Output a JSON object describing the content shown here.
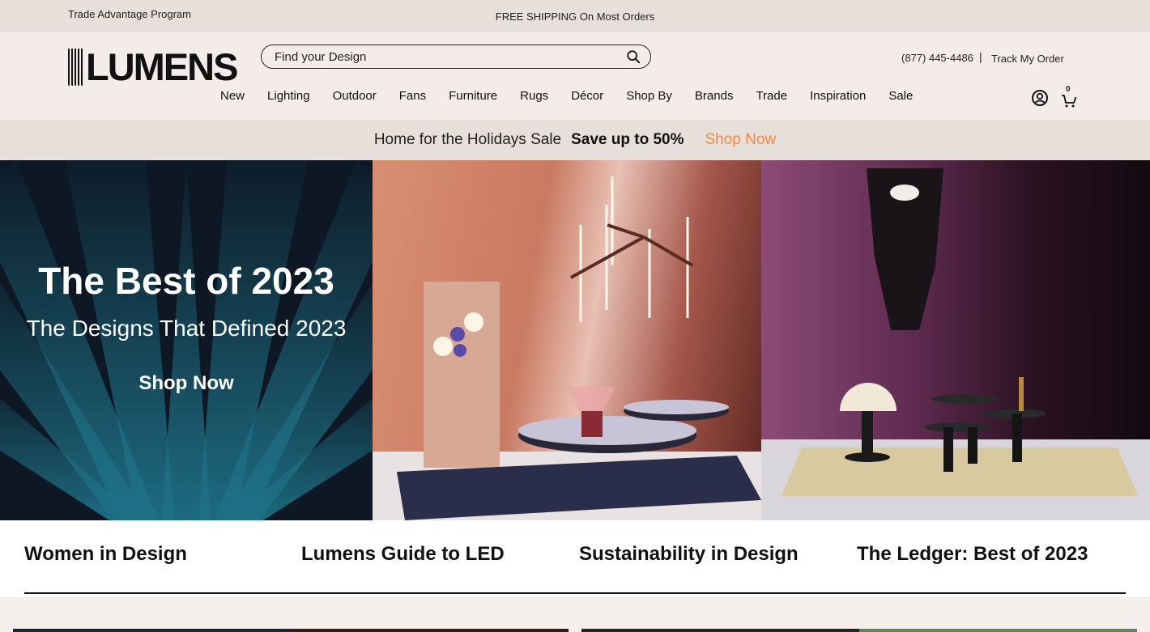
{
  "topbar": {
    "trade_program": "Trade Advantage Program",
    "shipping": "FREE SHIPPING On Most Orders"
  },
  "header": {
    "logo": "LUMENS",
    "search_placeholder": "Find your Design",
    "phone": "(877) 445-4486",
    "separator": "|",
    "track_order": "Track My Order",
    "cart_count": "0",
    "nav": [
      "New",
      "Lighting",
      "Outdoor",
      "Fans",
      "Furniture",
      "Rugs",
      "Décor",
      "Shop By",
      "Brands",
      "Trade",
      "Inspiration",
      "Sale"
    ]
  },
  "promo": {
    "text": "Home for the Holidays Sale",
    "highlight": "Save up to 50%",
    "cta": "Shop Now",
    "cta_color": "#f08a43"
  },
  "hero": {
    "title": "The Best of 2023",
    "subtitle": "The Designs That Defined 2023",
    "cta": "Shop Now"
  },
  "feature_links": [
    "Women in Design",
    "Lumens Guide to LED",
    "Sustainability in Design",
    "The Ledger: Best of 2023"
  ]
}
